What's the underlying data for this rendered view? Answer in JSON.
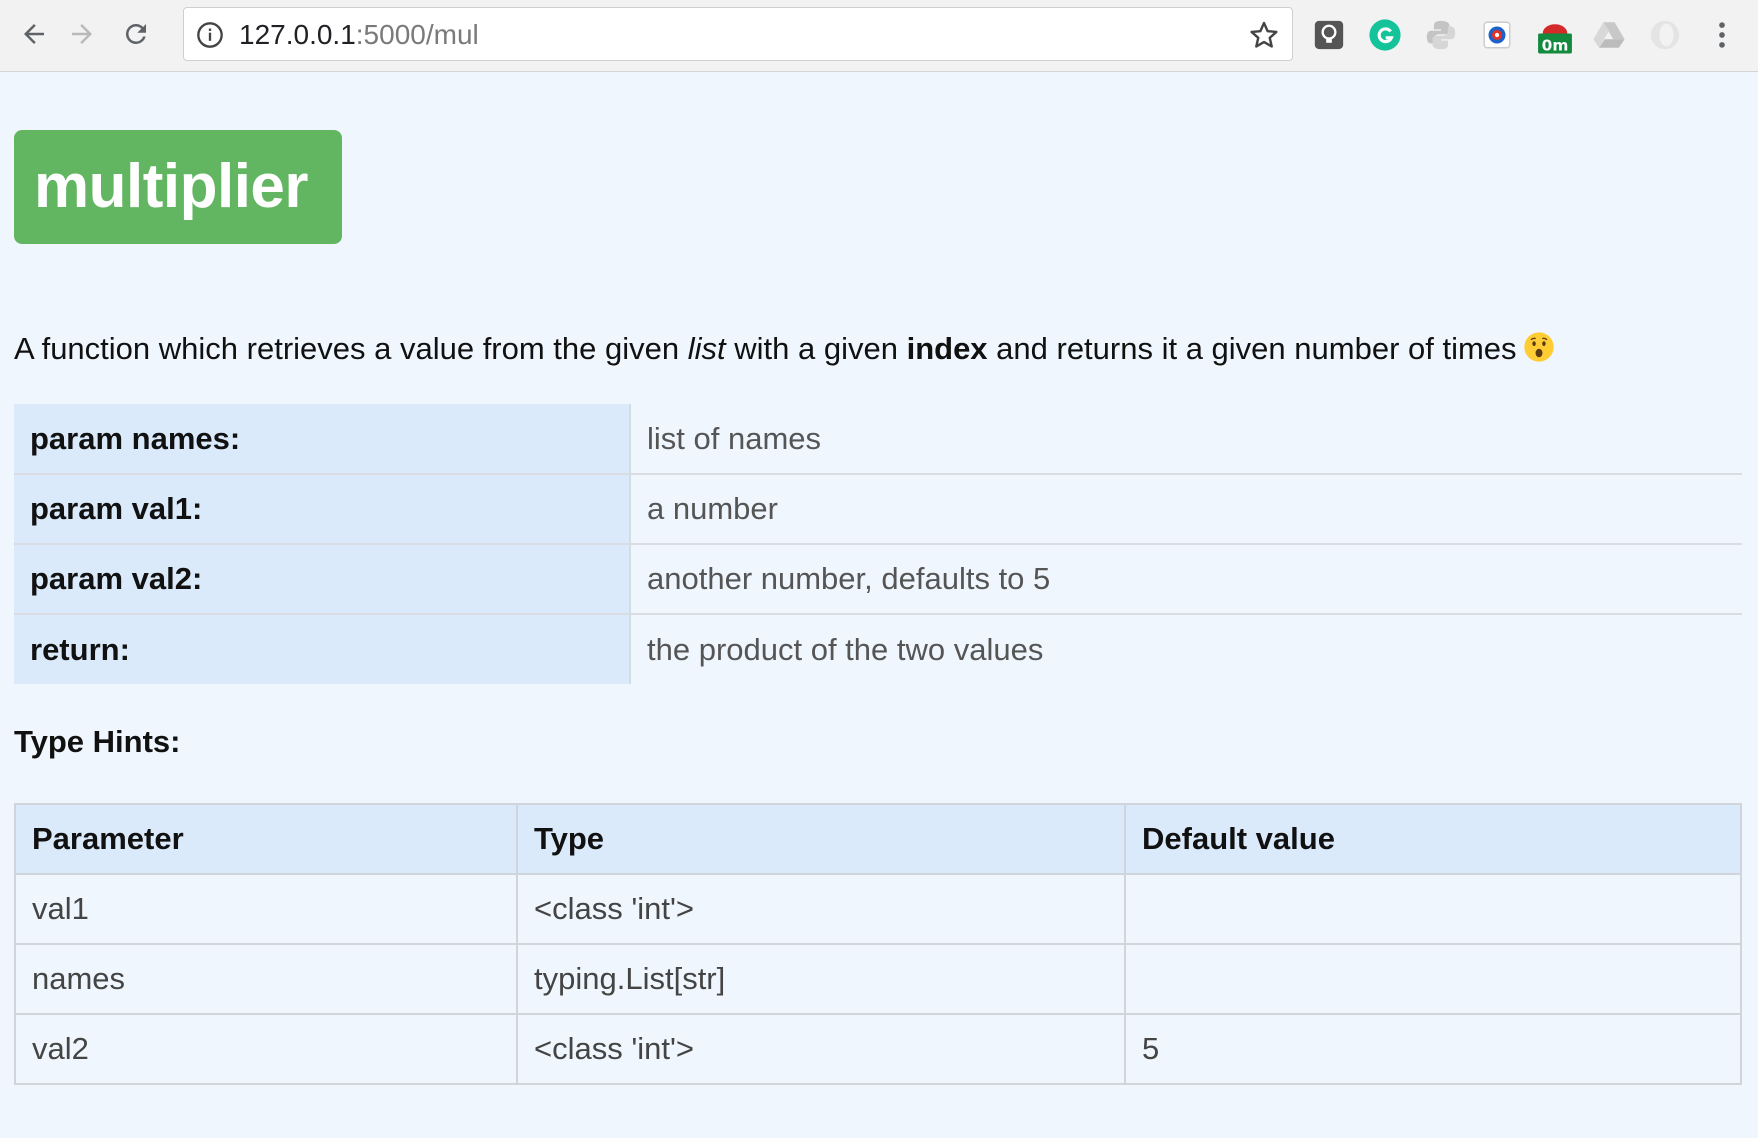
{
  "browser": {
    "url_host": "127.0.0.1",
    "url_path": ":5000/mul",
    "extensions": {
      "timer_badge": "0m"
    }
  },
  "page": {
    "title": "multiplier",
    "description": {
      "part1": "A function which retrieves a value from the given ",
      "italic": "list",
      "part2": " with a given ",
      "bold": "index",
      "part3": " and returns it a given number of times"
    },
    "params": [
      {
        "key": "param names:",
        "value": "list of names"
      },
      {
        "key": "param val1:",
        "value": "a number"
      },
      {
        "key": "param val2:",
        "value": "another number, defaults to 5"
      },
      {
        "key": "return:",
        "value": "the product of the two values"
      }
    ],
    "type_hints_title": "Type Hints:",
    "type_hints": {
      "headers": [
        "Parameter",
        "Type",
        "Default value"
      ],
      "rows": [
        [
          "val1",
          "<class 'int'>",
          ""
        ],
        [
          "names",
          "typing.List[str]",
          ""
        ],
        [
          "val2",
          "<class 'int'>",
          "5"
        ]
      ]
    }
  },
  "colors": {
    "title_badge_bg": "#62b662",
    "page_bg": "#eff6fe",
    "header_cell_bg": "#dbeafb"
  }
}
